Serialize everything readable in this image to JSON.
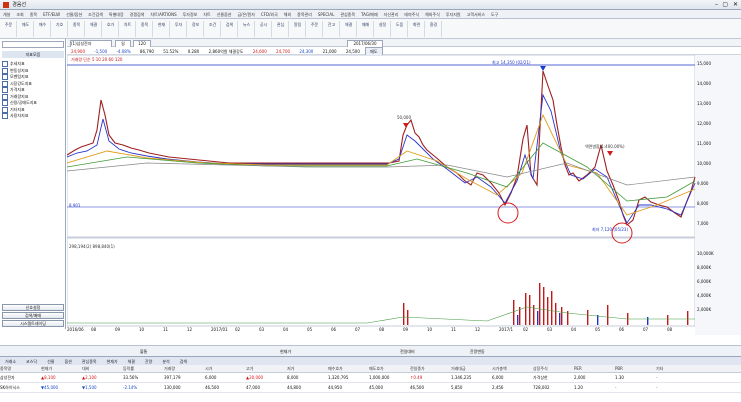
{
  "window": {
    "title": "경음선"
  },
  "menu": [
    "개설",
    "조회",
    "종목",
    "ETF/ELW",
    "선물/옵션",
    "조건검색",
    "특별대응",
    "경쟁검색",
    "차트/ARTIONS",
    "투자정보",
    "차트",
    "선물옵션",
    "금/은/원자",
    "CFD/외국",
    "해외",
    "종목관리",
    "SPECIAL",
    "관심종목",
    "TAG/매매",
    "자산관리",
    "테마주식",
    "해외주식",
    "투자지원",
    "고객서비스",
    "도구"
  ],
  "toolbar": [
    "주문",
    "매도",
    "매수",
    "기호",
    "종목",
    "체결",
    "호가",
    "차트",
    "종목",
    "현재",
    "투자",
    "정보",
    "조건",
    "검색",
    "뉴스",
    "공시",
    "관심",
    "알림",
    "주문",
    "잔고",
    "체결",
    "매매",
    "설정",
    "도움",
    "화면",
    "환경"
  ],
  "sidebar": {
    "title": "지표모음",
    "items": [
      "추세지표",
      "변동성지표",
      "모멘텀지표",
      "시장강도지표",
      "가격지표",
      "거래량지표",
      "신용/공매도지표",
      "기타지표",
      "사용자지표"
    ],
    "buttons": [
      "신호설정",
      "검색/매매",
      "시스템트레이딩",
      "나의 지표저장"
    ]
  },
  "chart_controls": {
    "code": "(1)삼성전자",
    "period": "일",
    "count": "120",
    "date": "2017/06/30",
    "labels": [
      "일",
      "주",
      "월",
      "분",
      "틱",
      "초"
    ]
  },
  "quote": {
    "open": "24,900",
    "high": "-1,500",
    "low": "-4.08%",
    "volume": "86,790",
    "change": "51.52%",
    "rate": "0.28X",
    "summary": "2,860억원 체결강도",
    "price": "24,600",
    "bid": "24,700",
    "ask": "24,300",
    "last": "21,000",
    "prev": "24,500",
    "tag": "매도"
  },
  "chart_annotations": {
    "max_label": "최고 14,350 (02/21)",
    "min_label": "최저 7,120 (05/23)",
    "event_top": "50,000",
    "event_mid": "액면병합(1:400.00%)",
    "left_price": "8,901",
    "volume_legend": "거래량 단순 5 10 20 60 120",
    "volume_values": "298,194(2) 898,840(1)"
  },
  "y_axis": [
    "15,000",
    "14,000",
    "13,000",
    "12,000",
    "11,000",
    "10,000",
    "9,000",
    "8,000",
    "7,000"
  ],
  "volume_axis": [
    "10,000K",
    "8,000K",
    "6,000K",
    "4,000K",
    "2,000K"
  ],
  "x_axis": [
    "2016/06",
    "08",
    "09",
    "10",
    "11",
    "12",
    "2017/01",
    "02",
    "03",
    "04",
    "05",
    "06",
    "07",
    "08",
    "09",
    "10",
    "11",
    "12",
    "2017/1",
    "02",
    "03",
    "04",
    "05",
    "06",
    "07",
    "08"
  ],
  "status": {
    "left": "불통",
    "mid": "현재가",
    "right": "전일대비",
    "label": "잔량변동"
  },
  "tabs": [
    "거래소",
    "코스닥",
    "선물",
    "옵션",
    "관심종목",
    "현재가",
    "체결",
    "잔량",
    "분석",
    "검색"
  ],
  "grid_headers": [
    "종목명",
    "현재가",
    "대비",
    "등락률",
    "거래량",
    "시가",
    "고가",
    "저가",
    "매수호가",
    "매도호가",
    "전일종가",
    "거래대금",
    "시가총액",
    "상장주식",
    "PER",
    "PBR",
    "기타"
  ],
  "grid_rows": [
    [
      "삼성전자",
      "▲8,100",
      "▲2,100",
      "33.56%",
      "397,179",
      "6,000",
      "▲20,000",
      "8,000",
      "1,320,795",
      "1,000,000",
      "↑0.49",
      "1,346,235",
      "6,000",
      "가격상한",
      "2,000",
      "1.30",
      "-"
    ],
    [
      "SK하이닉스",
      "▼45,000",
      "▼1,500",
      "-2.14%",
      "130,000",
      "46,500",
      "47,000",
      "44,800",
      "44,950",
      "45,000",
      "46,500",
      "5,850",
      "2,456",
      "728,002",
      "1.20",
      "-",
      "-"
    ]
  ]
}
